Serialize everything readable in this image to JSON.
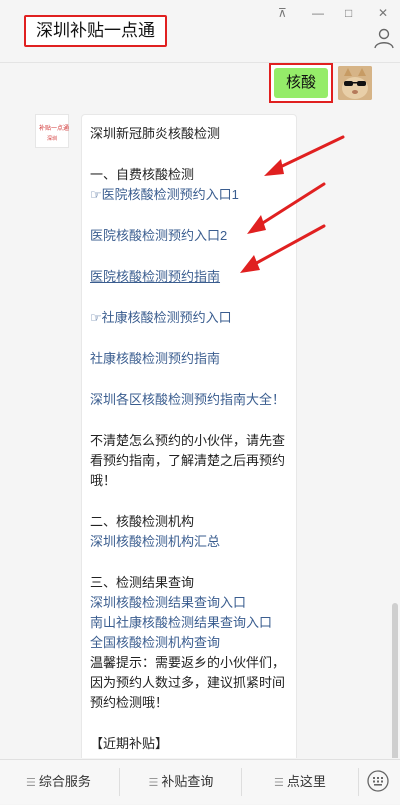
{
  "app": {
    "title": "深圳补贴一点通"
  },
  "window_controls": {
    "pin": "⊼",
    "minimize": "—",
    "maximize": "□",
    "close": "✕"
  },
  "chat": {
    "sent_message": "核酸",
    "bot_avatar": {
      "line1": "补贴一点通",
      "line2": "深圳"
    },
    "reply": {
      "title": "深圳新冠肺炎核酸检测",
      "section1_heading": "一、自费核酸检测",
      "link1": "☞医院核酸检测预约入口1",
      "link2": "医院核酸检测预约入口2",
      "link3": "医院核酸检测预约指南",
      "link4": "☞社康核酸检测预约入口",
      "link5": "社康核酸检测预约指南",
      "link6": "深圳各区核酸检测预约指南大全！",
      "note1": "不清楚怎么预约的小伙伴，请先查看预约指南，了解清楚之后再预约哦！",
      "section2_heading": "二、核酸检测机构",
      "link7": "深圳核酸检测机构汇总",
      "section3_heading": "三、检测结果查询",
      "link8": "深圳核酸检测结果查询入口",
      "link9": "南山社康核酸检测结果查询入口",
      "link10": "全国核酸检测机构查询",
      "tip": "温馨提示：需要返乡的小伙伴们，因为预约人数过多，建议抓紧时间预约检测哦！",
      "footer": "【近期补贴】"
    }
  },
  "bottom_menu": {
    "item1": "综合服务",
    "item2": "补贴查询",
    "item3": "点这里"
  },
  "colors": {
    "sent_bubble": "#95ec69",
    "link": "#3a5d8f",
    "highlight": "#e02020"
  }
}
